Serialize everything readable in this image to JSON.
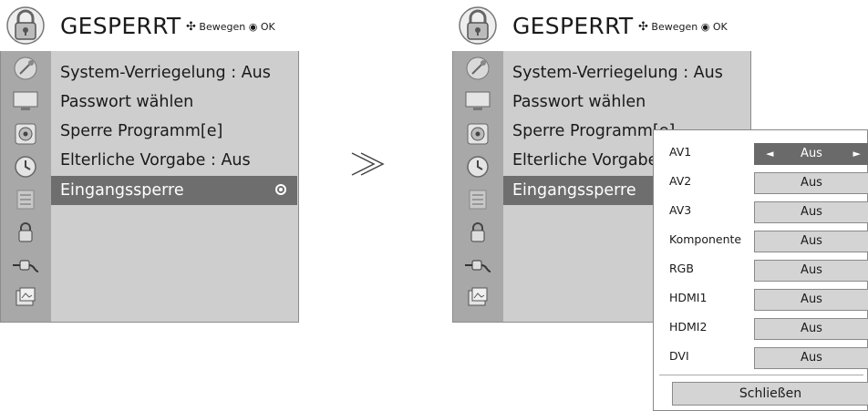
{
  "screens": [
    {
      "title": "GESPERRT",
      "hint_move": "Bewegen",
      "hint_ok": "OK",
      "items": [
        {
          "label": "System-Verriegelung : Aus"
        },
        {
          "label": "Passwort wählen"
        },
        {
          "label": "Sperre Programm[e]"
        },
        {
          "label": "Elterliche Vorgabe  : Aus"
        },
        {
          "label": "Eingangssperre"
        }
      ],
      "side_icons": [
        "satellite-dish-icon",
        "tv-screen-icon",
        "speaker-icon",
        "clock-icon",
        "options-icon",
        "lock-icon",
        "input-plug-icon",
        "photo-icon"
      ]
    },
    {
      "title": "GESPERRT",
      "hint_move": "Bewegen",
      "hint_ok": "OK",
      "items": [
        {
          "label": "System-Verriegelung : Aus"
        },
        {
          "label": "Passwort wählen"
        },
        {
          "label": "Sperre Programm[e]"
        },
        {
          "label": "Elterliche Vorgabe  : Aus"
        },
        {
          "label": "Eingangssperre"
        }
      ]
    }
  ],
  "transition_arrow": "≫",
  "popup": {
    "rows": [
      {
        "label": "AV1",
        "value": "Aus",
        "active": true
      },
      {
        "label": "AV2",
        "value": "Aus"
      },
      {
        "label": "AV3",
        "value": "Aus"
      },
      {
        "label": "Komponente",
        "value": "Aus"
      },
      {
        "label": "RGB",
        "value": "Aus"
      },
      {
        "label": "HDMI1",
        "value": "Aus"
      },
      {
        "label": "HDMI2",
        "value": "Aus"
      },
      {
        "label": "DVI",
        "value": "Aus"
      }
    ],
    "left_arrow": "◄",
    "right_arrow": "►",
    "close_label": "Schließen"
  },
  "colors": {
    "sidebar": "#a8a8a8",
    "panel": "#cecece",
    "selected": "#6e6e6e"
  }
}
